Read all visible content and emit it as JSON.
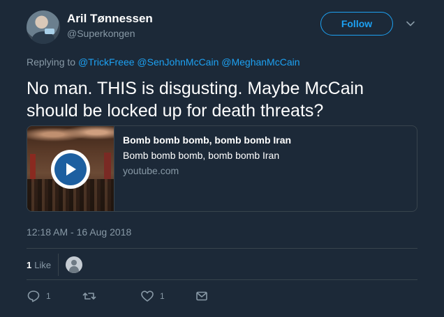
{
  "author": {
    "name": "Aril Tønnessen",
    "handle": "@Superkongen"
  },
  "follow_button": {
    "label": "Follow"
  },
  "reply": {
    "prefix": "Replying to",
    "mentions": [
      "@TrickFreee",
      "@SenJohnMcCain",
      "@MeghanMcCain"
    ]
  },
  "tweet": {
    "text": "No man. THIS is disgusting. Maybe McCain should be locked up for death threats?"
  },
  "card": {
    "title": "Bomb bomb bomb, bomb bomb Iran",
    "description": "Bomb bomb bomb, bomb bomb Iran",
    "domain": "youtube.com"
  },
  "timestamp": "12:18 AM - 16 Aug 2018",
  "likes": {
    "count": "1",
    "label": "Like"
  },
  "actions": {
    "reply_count": "1",
    "retweet_count": "",
    "like_count": "1"
  },
  "colors": {
    "background": "#1c2938",
    "accent": "#1da1f2",
    "muted": "#8899a6",
    "border": "#38444d"
  },
  "icons": [
    "chevron-down-icon",
    "play-icon",
    "reply-icon",
    "retweet-icon",
    "heart-icon",
    "mail-icon"
  ]
}
